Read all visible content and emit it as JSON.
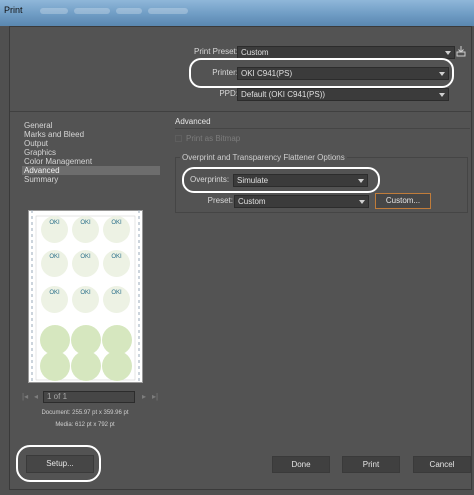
{
  "window": {
    "title": "Print"
  },
  "header": {
    "print_preset_label": "Print Preset:",
    "print_preset_value": "Custom",
    "printer_label": "Printer:",
    "printer_value": "OKI C941(PS)",
    "ppd_label": "PPD:",
    "ppd_value": "Default (OKI C941(PS))"
  },
  "sidebar": {
    "items": [
      {
        "label": "General"
      },
      {
        "label": "Marks and Bleed"
      },
      {
        "label": "Output"
      },
      {
        "label": "Graphics"
      },
      {
        "label": "Color Management"
      },
      {
        "label": "Advanced"
      },
      {
        "label": "Summary"
      }
    ],
    "selected": "Advanced"
  },
  "advanced": {
    "title": "Advanced",
    "print_as_bitmap": "Print as Bitmap",
    "group_title": "Overprint and Transparency Flattener Options",
    "overprints_label": "Overprints:",
    "overprints_value": "Simulate",
    "preset_label": "Preset:",
    "preset_value": "Custom",
    "custom_button": "Custom..."
  },
  "preview": {
    "page_field": "1 of 1",
    "document_size": "Document: 255.97 pt x 359.96 pt",
    "media_size": "Media: 612 pt x 792 pt",
    "label_text": "OKI"
  },
  "buttons": {
    "setup": "Setup...",
    "done": "Done",
    "print": "Print",
    "cancel": "Cancel"
  },
  "colors": {
    "circle_fill": "#d6e7bf",
    "highlight": "#ffffff",
    "selected_row": "#6d6d6d"
  }
}
